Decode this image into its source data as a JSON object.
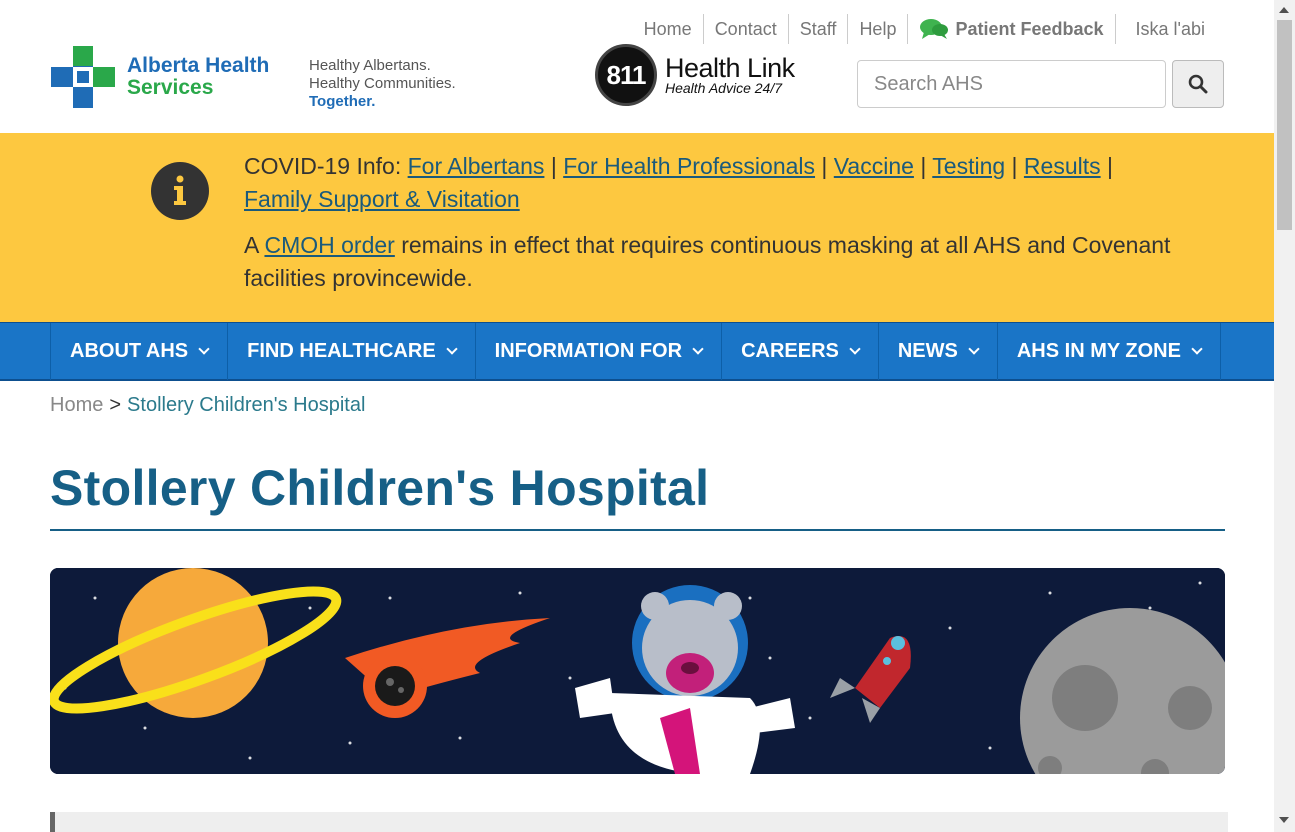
{
  "util_nav": {
    "home": "Home",
    "contact": "Contact",
    "staff": "Staff",
    "help": "Help",
    "feedback": "Patient Feedback",
    "language": "Iska l'abi"
  },
  "logo": {
    "line1": "Alberta Health",
    "line2": "Services"
  },
  "tagline": {
    "line1": "Healthy Albertans.",
    "line2": "Healthy Communities.",
    "line3": "Together."
  },
  "healthlink": {
    "number": "811",
    "title": "Health Link",
    "subtitle": "Health Advice 24/7"
  },
  "search": {
    "placeholder": "Search AHS"
  },
  "alert": {
    "prefix": "COVID-19 Info:",
    "links": [
      "For Albertans",
      "For Health Professionals",
      "Vaccine",
      "Testing",
      "Results",
      "Family Support & Visitation"
    ],
    "separator": "|",
    "p2_start": "A",
    "p2_link": "CMOH order",
    "p2_end": "remains in effect that requires continuous masking at all AHS and Covenant facilities provincewide."
  },
  "main_nav": [
    "ABOUT AHS",
    "FIND HEALTHCARE",
    "INFORMATION FOR",
    "CAREERS",
    "NEWS",
    "AHS IN MY ZONE"
  ],
  "breadcrumb": {
    "home": "Home",
    "separator": ">",
    "current": "Stollery Children's Hospital"
  },
  "page_title": "Stollery Children's Hospital",
  "colors": {
    "alert_bg": "#fdc840",
    "nav_bg": "#1a75c7",
    "title": "#165f86",
    "link": "#1a5a7c",
    "banner_bg": "#0d1a3a"
  }
}
